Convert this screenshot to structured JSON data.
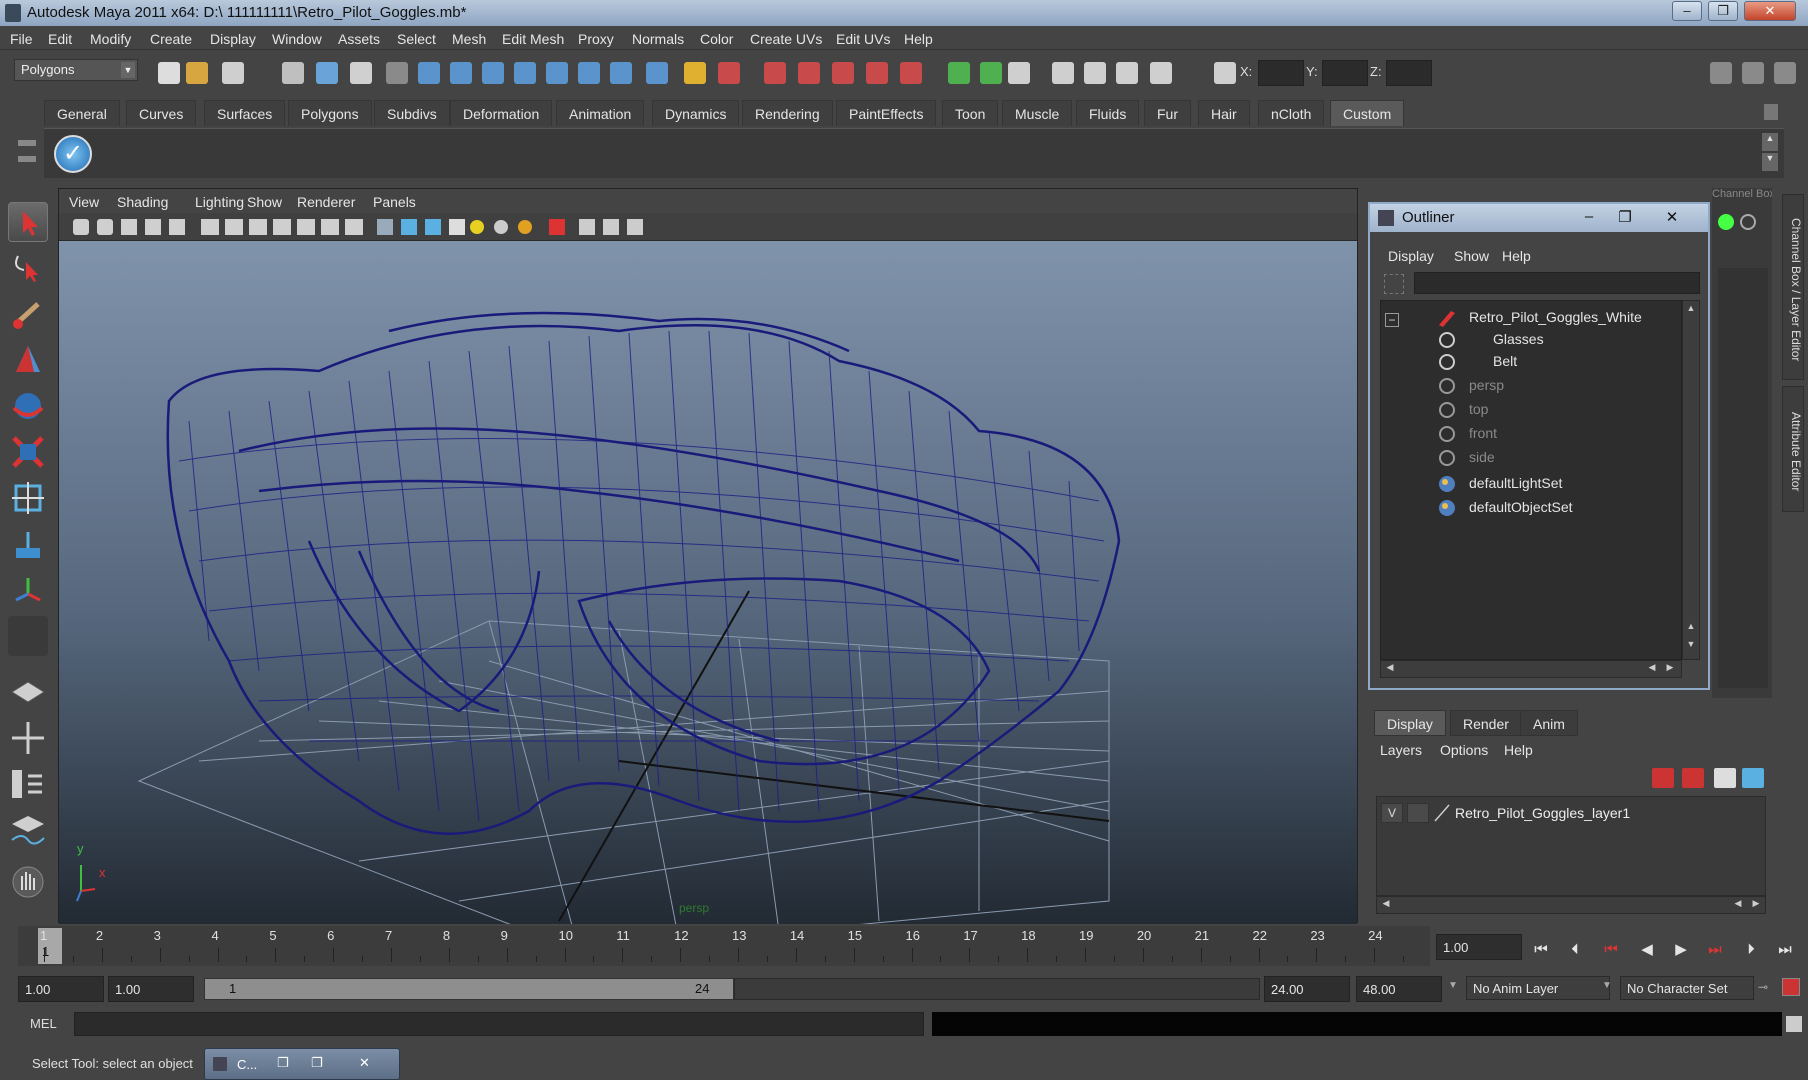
{
  "window": {
    "title": "Autodesk Maya 2011 x64: D:\\ 111111111\\Retro_Pilot_Goggles.mb*",
    "minimize": "–",
    "restore": "❐",
    "close": "✕"
  },
  "menubar": [
    "File",
    "Edit",
    "Modify",
    "Create",
    "Display",
    "Window",
    "Assets",
    "Select",
    "Mesh",
    "Edit Mesh",
    "Proxy",
    "Normals",
    "Color",
    "Create UVs",
    "Edit UVs",
    "Help"
  ],
  "statusline": {
    "mode": "Polygons",
    "x_label": "X:",
    "y_label": "Y:",
    "z_label": "Z:"
  },
  "shelf": {
    "tabs": [
      "General",
      "Curves",
      "Surfaces",
      "Polygons",
      "Subdivs",
      "Deformation",
      "Animation",
      "Dynamics",
      "Rendering",
      "PaintEffects",
      "Toon",
      "Muscle",
      "Fluids",
      "Fur",
      "Hair",
      "nCloth",
      "Custom"
    ],
    "active_tab": "Custom"
  },
  "viewport": {
    "menu": [
      "View",
      "Shading",
      "Lighting",
      "Show",
      "Renderer",
      "Panels"
    ],
    "camera": "persp",
    "axis_y": "y",
    "axis_x": "x",
    "wire_color": "#1a1a7a"
  },
  "outliner": {
    "title": "Outliner",
    "menu": [
      "Display",
      "Show",
      "Help"
    ],
    "items": [
      {
        "label": "Retro_Pilot_Goggles_White",
        "dim": false
      },
      {
        "label": "Glasses",
        "dim": false
      },
      {
        "label": "Belt",
        "dim": false
      },
      {
        "label": "persp",
        "dim": true
      },
      {
        "label": "top",
        "dim": true
      },
      {
        "label": "front",
        "dim": true
      },
      {
        "label": "side",
        "dim": true
      },
      {
        "label": "defaultLightSet",
        "dim": false
      },
      {
        "label": "defaultObjectSet",
        "dim": false
      }
    ],
    "collapse_symbol": "−"
  },
  "channel_box": {
    "header": "Channel Box / Layer Editor",
    "side_tabs": [
      "Channel Box / Layer Editor",
      "Attribute Editor"
    ]
  },
  "layer_editor": {
    "tabs": [
      "Display",
      "Render",
      "Anim"
    ],
    "active_tab": "Display",
    "menu": [
      "Layers",
      "Options",
      "Help"
    ],
    "layer": {
      "visible": "V",
      "name": "Retro_Pilot_Goggles_layer1"
    }
  },
  "timeline": {
    "ticks": [
      "1",
      "2",
      "3",
      "4",
      "5",
      "6",
      "7",
      "8",
      "9",
      "10",
      "11",
      "12",
      "13",
      "14",
      "15",
      "16",
      "17",
      "18",
      "19",
      "20",
      "21",
      "22",
      "23",
      "24"
    ],
    "current_frame_label": "1",
    "current_time": "1.00"
  },
  "range": {
    "start_time": "1.00",
    "playback_start": "1.00",
    "range_start_label": "1",
    "range_end_label": "24",
    "playback_end": "24.00",
    "end_time": "48.00",
    "anim_layer": "No Anim Layer",
    "character_set": "No Character Set"
  },
  "commandline": {
    "label": "MEL"
  },
  "helpline": {
    "text": "Select Tool: select an object",
    "mini_title": "C..."
  }
}
